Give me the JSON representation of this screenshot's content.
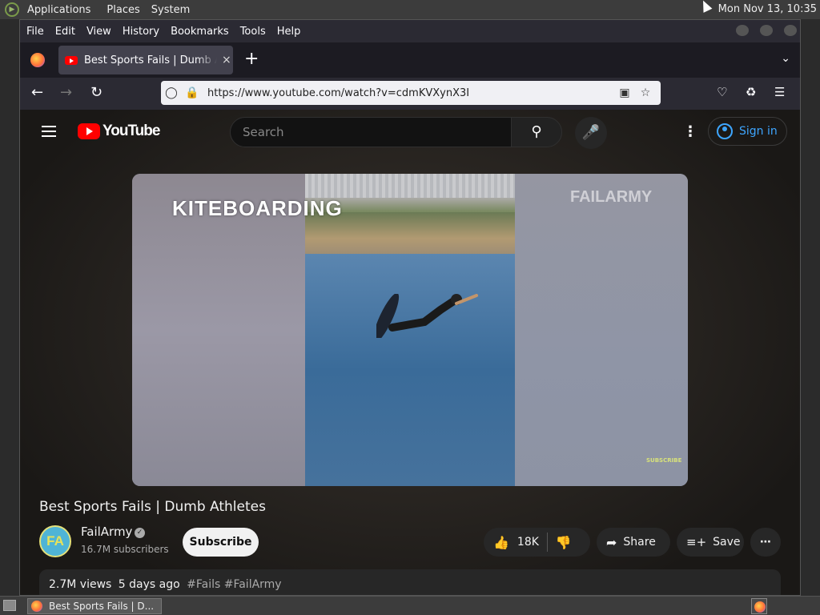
{
  "top_panel": {
    "menus": [
      "Applications",
      "Places",
      "System"
    ],
    "clock": "Mon Nov 13, 10:35"
  },
  "browser": {
    "menu": [
      "File",
      "Edit",
      "View",
      "History",
      "Bookmarks",
      "Tools",
      "Help"
    ],
    "tab": {
      "title": "Best Sports Fails | Dumb Athletes",
      "close": "×"
    },
    "new_tab": "+",
    "url": "https://www.youtube.com/watch?v=cdmKVXynX3I"
  },
  "youtube": {
    "logo_text": "YouTube",
    "search_placeholder": "Search",
    "sign_in": "Sign in",
    "video": {
      "caption": "KITEBOARDING",
      "watermark": "FAILARMY",
      "corner_mark": "SUBSCRIBE"
    },
    "title": "Best Sports Fails | Dumb Athletes",
    "channel": {
      "avatar_text": "FA",
      "name": "FailArmy",
      "subscribers": "16.7M subscribers"
    },
    "subscribe": "Subscribe",
    "likes": "18K",
    "share": "Share",
    "save": "Save",
    "description": {
      "views": "2.7M views",
      "age": "5 days ago",
      "tags": "#Fails #FailArmy"
    }
  },
  "taskbar": {
    "window_title": "Best Sports Fails | D..."
  }
}
